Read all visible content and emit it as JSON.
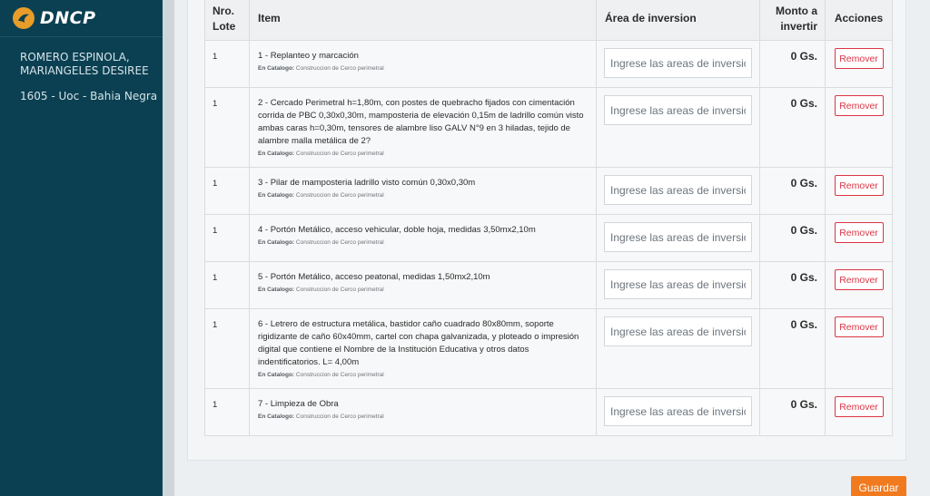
{
  "brand": {
    "logo_text": "DNCP"
  },
  "user": {
    "name": "ROMERO ESPINOLA, MARIANGELES DESIREE",
    "unit": "1605 - Uoc - Bahia Negra"
  },
  "table": {
    "headers": {
      "lote": "Nro. Lote",
      "item": "Item",
      "area": "Área de inversion",
      "monto": "Monto a invertir",
      "acciones": "Acciones"
    },
    "catalog_prefix": "En Catalogo:",
    "area_placeholder": "Ingrese las areas de inversión",
    "remove_label": "Remover",
    "rows": [
      {
        "lote": "1",
        "description": "1 - Replanteo y marcación",
        "catalog": "Construccion de Cerco perimetral",
        "monto": "0 Gs."
      },
      {
        "lote": "1",
        "description": "2 - Cercado Perimetral h=1,80m, con postes de quebracho fijados con cimentación corrida de PBC 0,30x0,30m, mamposteria de elevación 0,15m de ladrillo común visto ambas caras h=0,30m, tensores de alambre liso GALV N°9 en 3 hiladas, tejido de alambre malla metálica de 2?",
        "catalog": "Construccion de Cerco perimetral",
        "monto": "0 Gs."
      },
      {
        "lote": "1",
        "description": "3 - Pilar de mamposteria ladrillo visto común 0,30x0,30m",
        "catalog": "Construccion de Cerco perimetral",
        "monto": "0 Gs."
      },
      {
        "lote": "1",
        "description": "4 - Portón Metálico, acceso vehicular, doble hoja, medidas 3,50mx2,10m",
        "catalog": "Construccion de Cerco perimetral",
        "monto": "0 Gs."
      },
      {
        "lote": "1",
        "description": "5 - Portón Metálico, acceso peatonal, medidas 1,50mx2,10m",
        "catalog": "Construccion de Cerco perimetral",
        "monto": "0 Gs."
      },
      {
        "lote": "1",
        "description": "6 - Letrero de estructura metálica, bastidor caño cuadrado 80x80mm, soporte rigidizante de caño 60x40mm, cartel con chapa galvanizada, y ploteado o impresión digital que contiene el Nombre de la Institución Educativa y otros datos indentificatorios. L= 4,00m",
        "catalog": "Construccion de Cerco perimetral",
        "monto": "0 Gs."
      },
      {
        "lote": "1",
        "description": "7 - Limpieza de Obra",
        "catalog": "Construccion de Cerco perimetral",
        "monto": "0 Gs."
      }
    ]
  },
  "actions": {
    "save_label": "Guardar"
  },
  "colors": {
    "sidebar": "#0b4052",
    "accent": "#f17a1f",
    "danger": "#dc3545"
  },
  "icons": {
    "logo": "dncp-logo-icon"
  }
}
